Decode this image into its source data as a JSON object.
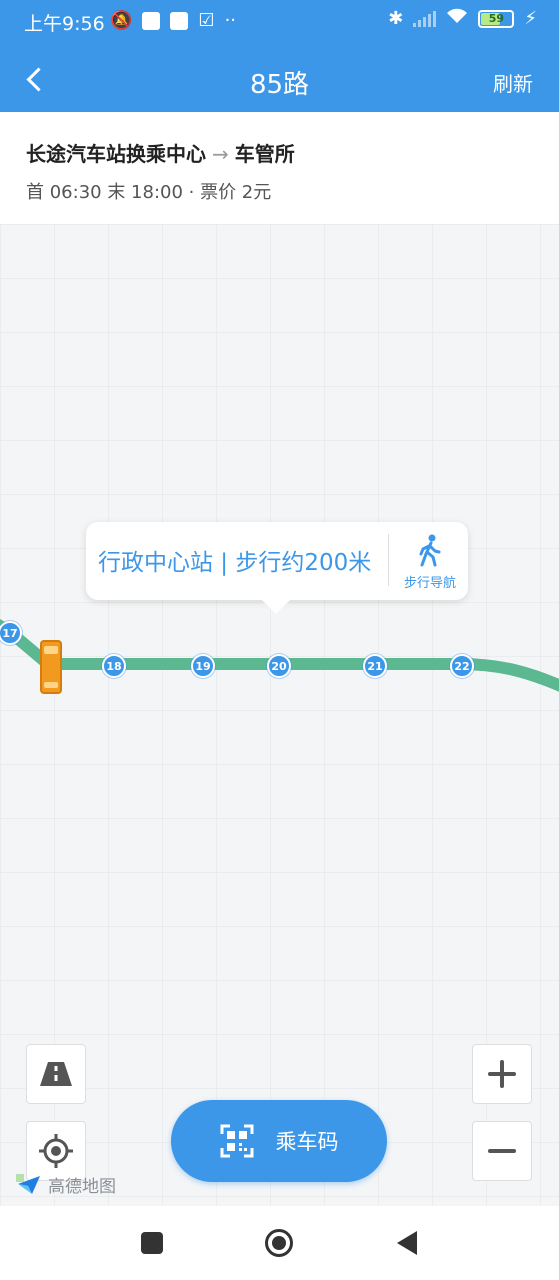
{
  "status_bar": {
    "time": "上午9:56",
    "battery": "59"
  },
  "header": {
    "title": "85路",
    "refresh_label": "刷新"
  },
  "route": {
    "origin": "长途汽车站换乘中心",
    "arrow": "→",
    "destination": "车管所",
    "meta": "首 06:30 末 18:00 · 票价 2元"
  },
  "map": {
    "stops": [
      "17",
      "18",
      "19",
      "20",
      "21",
      "22"
    ],
    "callout": {
      "stop_text": "行政中心站 | 步行约200米",
      "walk_label": "步行导航"
    },
    "ride_code_label": "乘车码",
    "logo_text": "高德地图"
  },
  "colors": {
    "brand": "#3d97e8",
    "route_line": "#5cb891",
    "bus": "#f29a1f"
  }
}
